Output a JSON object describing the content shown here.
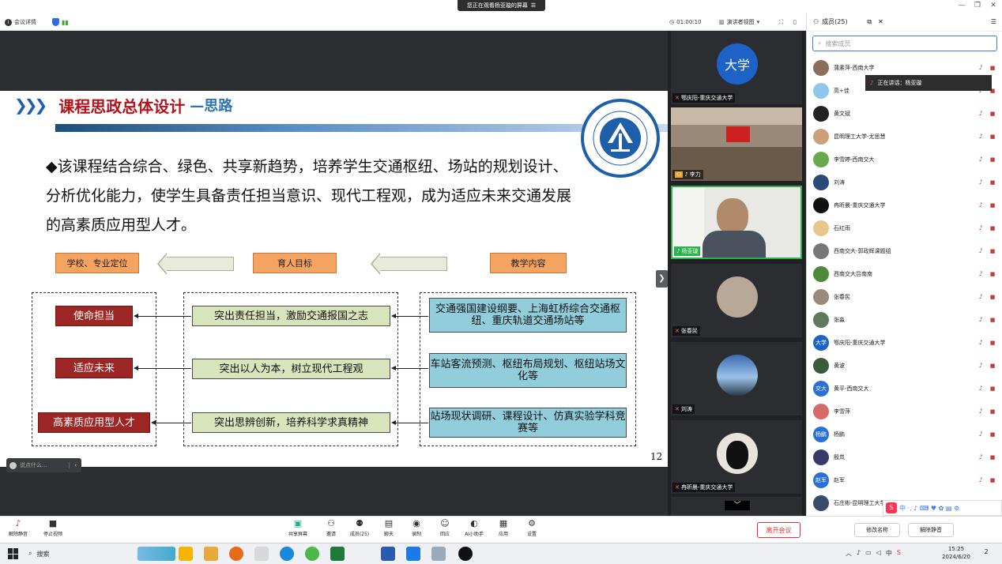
{
  "titlebar": {
    "banner": "您正在观看杨亚璇的屏幕",
    "minimize": "—",
    "restore": "❐",
    "close": "✕"
  },
  "infobar": {
    "meeting_details": "会议详情",
    "timer": "01:00:10",
    "view_mode": "演讲者视图"
  },
  "slide": {
    "title_main": "课程思政总体设计",
    "title_sub": "—思路",
    "bullet": "该课程结合综合、绿色、共享新趋势，培养学生交通枢纽、场站的规划设计、分析优化能力，使学生具备责任担当意识、现代工程观，成为适应未来交通发展的高素质应用型人才。",
    "header_left": "学校、专业定位",
    "header_mid": "育人目标",
    "header_right": "教学内容",
    "pos1": "使命担当",
    "pos2": "适应未来",
    "pos3": "高素质应用型人才",
    "goal1": "突出责任担当，激励交通报国之志",
    "goal2": "突出以人为本，树立现代工程观",
    "goal3": "突出思辨创新，培养科学求真精神",
    "content1": "交通强国建设纲要、上海虹桥综合交通枢纽、重庆轨道交通场站等",
    "content2": "车站客流预测、枢纽布局规划、枢纽站场文化等",
    "content3": "站场现状调研、课程设计、仿真实验学科竞赛等",
    "page_number": "12"
  },
  "caption_bar": {
    "text": "说点什么..."
  },
  "videos": [
    {
      "name": "鄂庆阳-重庆交通大学",
      "avatar_text": "大学"
    },
    {
      "name": "李力"
    },
    {
      "name": "杨亚璇"
    },
    {
      "name": "张春民"
    },
    {
      "name": "刘涛"
    },
    {
      "name": "冉昕晨-重庆交通大学"
    }
  ],
  "members": {
    "title": "成员(25)",
    "search_placeholder": "搜索成员",
    "speaking": "正在讲话：杨亚璇",
    "list": [
      {
        "name": "蒲素萍-西南大学",
        "avatar": "",
        "color": "#8a6d5a"
      },
      {
        "name": "高+佳",
        "avatar": "",
        "color": "#8fc6ea"
      },
      {
        "name": "黄文斌",
        "avatar": "",
        "color": "#222222"
      },
      {
        "name": "昆明理工大学-尤思慧",
        "avatar": "",
        "color": "#c9a27a"
      },
      {
        "name": "李雪婷-西南交大",
        "avatar": "",
        "color": "#6aa84f"
      },
      {
        "name": "刘涛",
        "avatar": "",
        "color": "#2a4a7a"
      },
      {
        "name": "冉昕晨-重庆交通大学",
        "avatar": "",
        "color": "#111111"
      },
      {
        "name": "石红雨",
        "avatar": "",
        "color": "#e8c58a"
      },
      {
        "name": "西南交大-郭政辉课题组",
        "avatar": "",
        "color": "#777777"
      },
      {
        "name": "西南交大吕南南",
        "avatar": "",
        "color": "#4f8a3a"
      },
      {
        "name": "张春民",
        "avatar": "",
        "color": "#9a8a7a"
      },
      {
        "name": "张淼",
        "avatar": "",
        "color": "#5c7a5c"
      },
      {
        "name": "鄂庆阳-重庆交通大学",
        "avatar": "大学",
        "color": "#1e62c8"
      },
      {
        "name": "黄波",
        "avatar": "",
        "color": "#3a5a3a"
      },
      {
        "name": "黄平-西南交大",
        "avatar": "交大",
        "color": "#2a6fd6"
      },
      {
        "name": "李雪萍",
        "avatar": "",
        "color": "#d46a6a"
      },
      {
        "name": "杨鹏",
        "avatar": "杨鹏",
        "color": "#2a6fd6"
      },
      {
        "name": "殷岚",
        "avatar": "",
        "color": "#3a3a6a"
      },
      {
        "name": "赵军",
        "avatar": "赵军",
        "color": "#2a6fd6"
      },
      {
        "name": "石庄彬-昆明理工大学",
        "avatar": "",
        "color": "#3a4a6a"
      }
    ],
    "rename_button": "修改名称",
    "unmute_button": "解除静音"
  },
  "toolbar": {
    "unmute": "解除静音",
    "stop_video": "停止视频",
    "share": "共享屏幕",
    "invite": "邀请",
    "members": "成员(25)",
    "chat": "聊天",
    "record": "录制",
    "reaction": "回应",
    "ai": "AI小助手",
    "apps": "应用",
    "settings": "设置",
    "leave": "离开会议"
  },
  "taskbar": {
    "search": "搜索",
    "time": "15:25",
    "date": "2024/6/20",
    "lang": "中",
    "notif": "2"
  },
  "ime": {
    "text": "中 ·, ♪ ⌨ ♥ ✿ ▤ ⚙"
  }
}
